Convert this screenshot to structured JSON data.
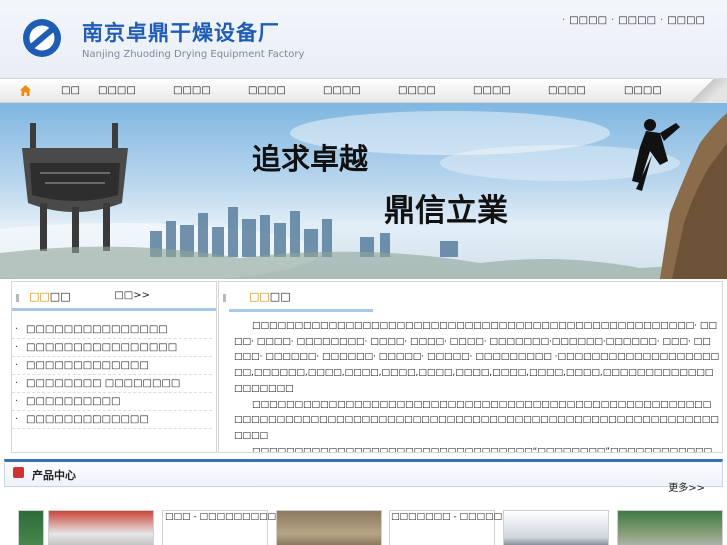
{
  "header": {
    "brand_cn": "南京卓鼎干燥设备厂",
    "brand_en": "Nanjing Zhuoding Drying Equipment Factory",
    "toplinks": [
      "□□□□",
      "□□□□",
      "□□□□"
    ],
    "separator": "·"
  },
  "nav": {
    "items": [
      "□□",
      "□□□□",
      "□□□□",
      "□□□□",
      "□□□□",
      "□□□□",
      "□□□□",
      "□□□□",
      "□□□□"
    ]
  },
  "banner": {
    "slogan_1": "追求卓越",
    "slogan_2": "鼎信立業"
  },
  "news": {
    "title_hl": "□□",
    "title_rest": "□□",
    "more": "□□>>",
    "items": [
      "□□□□□□□□□□□□□□□",
      "□□□□□□□□□□□□□□□□",
      "□□□□□□□□□□□□□",
      "□□□□□□□□ □□□□□□□□",
      "□□□□□□□□□□",
      "□□□□□□□□□□□□□"
    ]
  },
  "about": {
    "title_hl": "□□",
    "title_rest": "□□",
    "paragraphs": [
      "□□□□□□□□□□□□□□□□□□□□□□□□□□□□□□□□□□□□□□□□□□□□□□□□□□□□· □□□□· □□□□· □□□□□□□□· □□□□· □□□□· □□□□· □□□□□□□·□□□□□□·□□□□□□· □□□· □□□□□· □□□□□□· □□□□□□· □□□□□· □□□□□· □□□□□□□□□ ·□□□□□□□□□□□□□□□□□□□□□,□□□□□□,□□□□,□□□□,□□□□,□□□□,□□□□,□□□□,□□□□,□□□□,□□□□□□□□□□□□□□□□□□□□",
      "□□□□□□□□□□□□□□□□□□□□□□□□□□□□□□□□□□□□□□□□□□□□□□□□□□□□□□□□□□□□□□□□□□□□□□□□□□□□□□□□□□□□□□□□□□□□□□□□□□□□□□□□□□□□□□□□□□□",
      "□□□□□□□□□□□□□□□□□□□□□□□□□□□□□□□□□“□□□□□□□□”□□□□□□□□□□□□□□□□□□□□□□□□□□□□□□□□□□□□□□□□□□□□□□□□□□□□□□□□□□□□□□□□□□□□□□□□□□□□”□□□□□□□□”□□□□□□□□□□□□□□□□□□□□□□□□□□□□□□□□□□□□□□□□□□□□□□□□□□□□□□□□□□□□□□□□□,□□□□□□,□□□□,□□□□,□□□□,□□□□,□□□□,□□□□,□□□□,□□□□□□□□□□□□□□□□□□□□□□□□□□□□□□□□□□□□□□□□□□□□□□□□□□□□□□□□□□□□□□□"
    ]
  },
  "products": {
    "title": "产品中心",
    "more": "更多>>",
    "captions": [
      "□□□ - □□□□□□□□□",
      "□□□□□□□ - □□□□□□□□□"
    ]
  },
  "colors": {
    "brand_blue": "#1f5db5",
    "accent_orange": "#e08a10",
    "bar_blue": "#3a6fb6"
  }
}
